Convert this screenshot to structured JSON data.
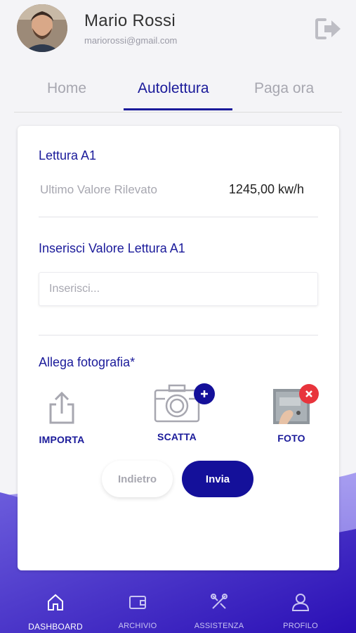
{
  "user": {
    "name": "Mario Rossi",
    "email": "mariorossi@gmail.com"
  },
  "icons": {
    "logout": "logout-icon",
    "upload": "upload-icon",
    "camera": "camera-icon",
    "add": "plus-icon",
    "remove": "close-icon"
  },
  "tabs": [
    {
      "label": "Home",
      "active": false
    },
    {
      "label": "Autolettura",
      "active": true
    },
    {
      "label": "Paga ora",
      "active": false
    }
  ],
  "reading": {
    "title": "Lettura A1",
    "last_label": "Ultimo Valore Rilevato",
    "last_value": "1245,00 kw/h",
    "input_title": "Inserisci Valore Lettura A1",
    "input_placeholder": "Inserisci..."
  },
  "attachments": {
    "title": "Allega fotografia*",
    "items": [
      {
        "label": "IMPORTA"
      },
      {
        "label": "SCATTA"
      },
      {
        "label": "FOTO"
      }
    ]
  },
  "actions": {
    "back_label": "Indietro",
    "send_label": "Invia"
  },
  "nav": [
    {
      "label": "DASHBOARD",
      "active": true
    },
    {
      "label": "ARCHIVIO",
      "active": false
    },
    {
      "label": "ASSISTENZA",
      "active": false
    },
    {
      "label": "PROFILO",
      "active": false
    }
  ],
  "colors": {
    "primary": "#1a1a9a",
    "gradient_start": "#6a5ad8",
    "gradient_end": "#2a0fb8",
    "remove_badge": "#e8343c"
  }
}
